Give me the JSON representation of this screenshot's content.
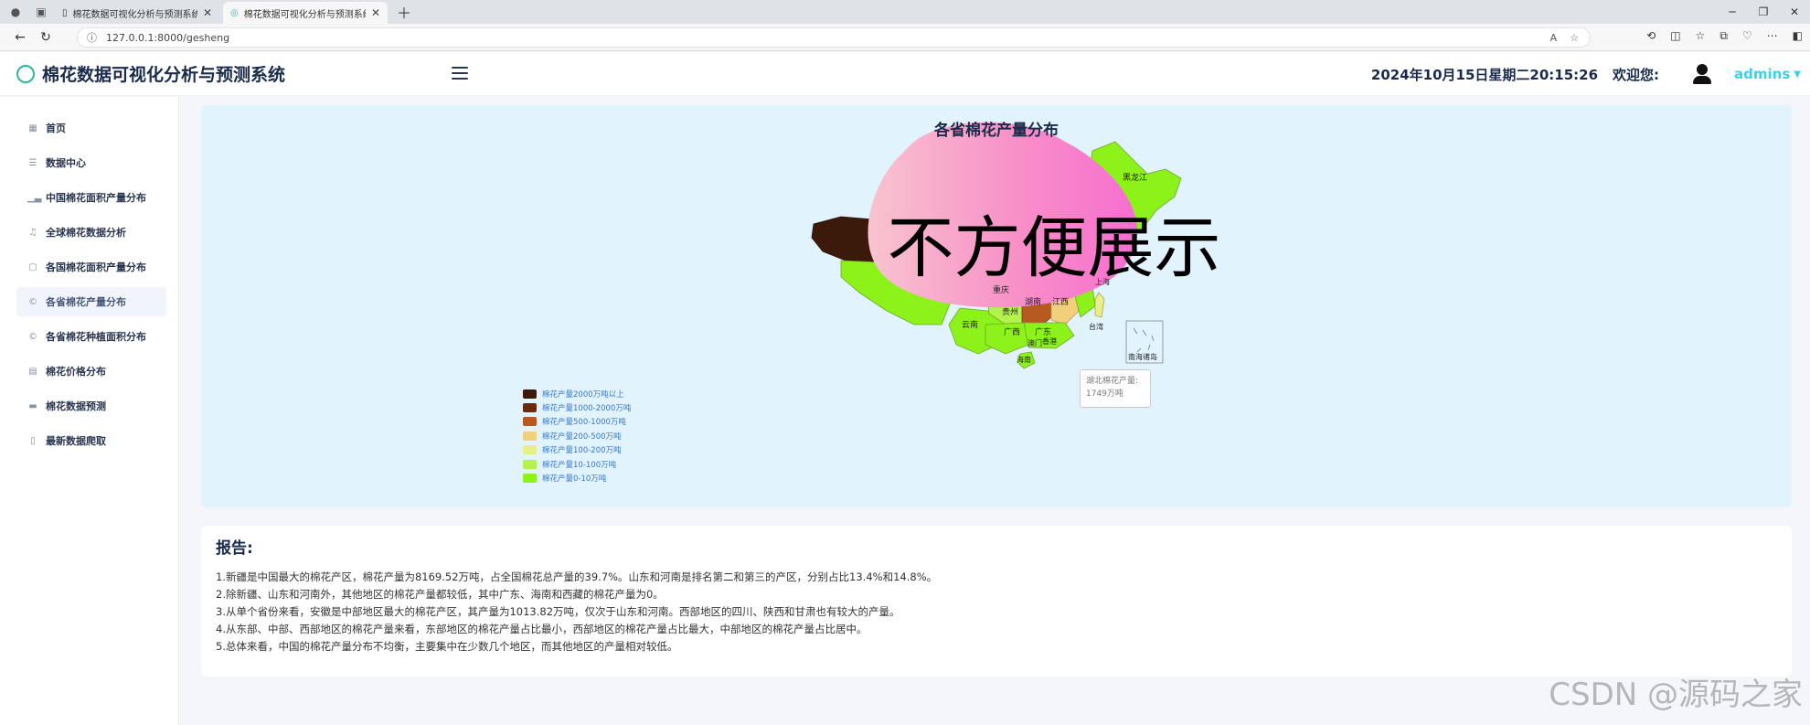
{
  "browser": {
    "tabs": [
      {
        "title": "棉花数据可视化分析与预测系统",
        "active": false
      },
      {
        "title": "棉花数据可视化分析与预测系统",
        "active": true
      }
    ],
    "url": "127.0.0.1:8000/gesheng"
  },
  "header": {
    "title": "棉花数据可视化分析与预测系统",
    "datetime": "2024年10月15日星期二20:15:26",
    "welcome": "欢迎您:",
    "username": "admins"
  },
  "sidebar": {
    "items": [
      {
        "label": "首页",
        "icon": "grid-icon",
        "active": false
      },
      {
        "label": "数据中心",
        "icon": "database-icon",
        "active": false
      },
      {
        "label": "中国棉花面积产量分布",
        "icon": "bar-chart-icon",
        "active": false
      },
      {
        "label": "全球棉花数据分析",
        "icon": "bell-icon",
        "active": false
      },
      {
        "label": "各国棉花面积产量分布",
        "icon": "calendar-icon",
        "active": false
      },
      {
        "label": "各省棉花产量分布",
        "icon": "copyright-icon",
        "active": true
      },
      {
        "label": "各省棉花种植面积分布",
        "icon": "copyright-icon",
        "active": false
      },
      {
        "label": "棉花价格分布",
        "icon": "archive-icon",
        "active": false
      },
      {
        "label": "棉花数据预测",
        "icon": "table-icon",
        "active": false
      },
      {
        "label": "最新数据爬取",
        "icon": "file-icon",
        "active": false
      }
    ]
  },
  "map": {
    "title": "各省棉花产量分布",
    "legend": [
      {
        "label": "棉花产量2000万吨以上",
        "color": "#3b1a0b"
      },
      {
        "label": "棉花产量1000-2000万吨",
        "color": "#6b2b10"
      },
      {
        "label": "棉花产量500-1000万吨",
        "color": "#b65a22"
      },
      {
        "label": "棉花产量200-500万吨",
        "color": "#f2cf7a"
      },
      {
        "label": "棉花产量100-200万吨",
        "color": "#e7ee8a"
      },
      {
        "label": "棉花产量10-100万吨",
        "color": "#b3f24f"
      },
      {
        "label": "棉花产量0-10万吨",
        "color": "#8cf21a"
      }
    ],
    "province_labels": {
      "heilongjiang": "黑龙江",
      "chongqing": "重庆",
      "hunan": "湖南",
      "jiangxi": "江西",
      "guizhou": "贵州",
      "yunnan": "云南",
      "guangxi": "广西",
      "guangdong": "广东",
      "aomen": "澳门",
      "xianggang": "香港",
      "taiwan": "台湾",
      "hainan": "海南",
      "nanhai": "南海诸岛",
      "shanghai": "上海"
    },
    "tooltip": {
      "line1": "湖北棉花产量:",
      "line2": "1749万吨"
    },
    "overlay_text": "不方便展示"
  },
  "report": {
    "title": "报告:",
    "lines": [
      "1.新疆是中国最大的棉花产区，棉花产量为8169.52万吨，占全国棉花总产量的39.7%。山东和河南是排名第二和第三的产区，分别占比13.4%和14.8%。",
      "2.除新疆、山东和河南外，其他地区的棉花产量都较低，其中广东、海南和西藏的棉花产量为0。",
      "3.从单个省份来看，安徽是中部地区最大的棉花产区，其产量为1013.82万吨，仅次于山东和河南。西部地区的四川、陕西和甘肃也有较大的产量。",
      "4.从东部、中部、西部地区的棉花产量来看，东部地区的棉花产量占比最小，西部地区的棉花产量占比最大，中部地区的棉花产量占比居中。",
      "5.总体来看，中国的棉花产量分布不均衡，主要集中在少数几个地区，而其他地区的产量相对较低。"
    ]
  },
  "watermark": "CSDN @源码之家"
}
